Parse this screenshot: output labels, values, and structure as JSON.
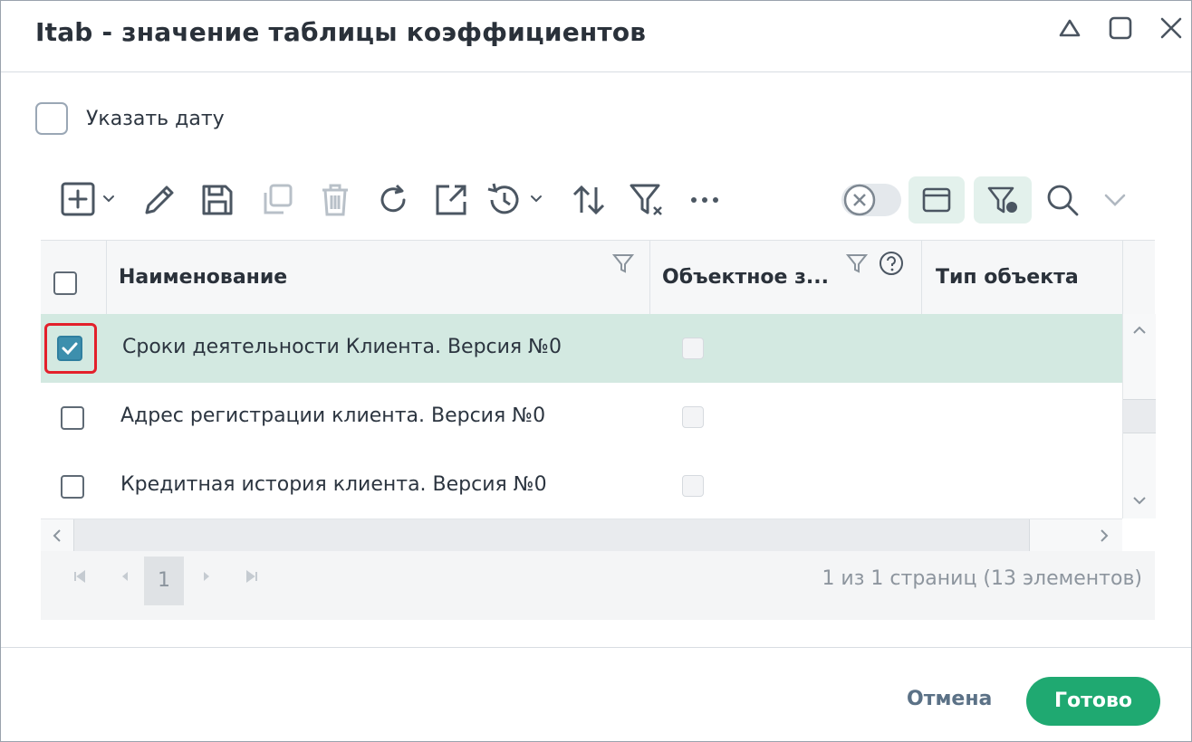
{
  "window": {
    "title": "Itab - значение таблицы коэффициентов",
    "controls": [
      "minimize-icon",
      "maximize-icon",
      "close-icon"
    ]
  },
  "date_option": {
    "label": "Указать дату",
    "checked": false
  },
  "toolbar": {
    "buttons": [
      "add-icon",
      "edit-icon",
      "save-icon",
      "copy-icon",
      "delete-icon",
      "refresh-icon",
      "export-icon",
      "history-icon",
      "sort-icon",
      "clear-filter-icon",
      "more-icon"
    ],
    "right_buttons": [
      "toggle-clear-icon",
      "window-icon",
      "filter-settings-icon",
      "search-icon",
      "chevron-down-icon"
    ]
  },
  "grid": {
    "columns": [
      {
        "label": "Наименование",
        "filter": true
      },
      {
        "label": "Объектное з...",
        "filter": true,
        "help": true
      },
      {
        "label": "Тип объекта"
      }
    ],
    "rows": [
      {
        "name": "Сроки деятельности Клиента. Версия №0",
        "selected": true,
        "object": false
      },
      {
        "name": "Адрес регистрации клиента. Версия №0",
        "selected": false,
        "object": false
      },
      {
        "name": "Кредитная история клиента. Версия №0",
        "selected": false,
        "object": false
      }
    ]
  },
  "pager": {
    "current_page": "1",
    "info": "1 из 1 страниц (13 элементов)"
  },
  "footer": {
    "cancel_label": "Отмена",
    "ok_label": "Готово"
  },
  "colors": {
    "accent": "#1fa971",
    "selected_row": "#d3e9e1",
    "checkbox_checked": "#3d8fad",
    "highlight_box": "#e3202b"
  }
}
